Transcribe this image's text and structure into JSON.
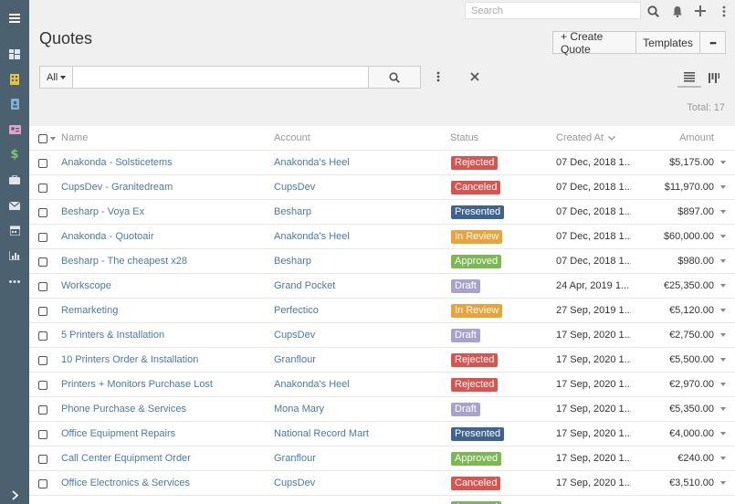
{
  "app": {
    "title": "Quotes"
  },
  "topbar": {
    "search_placeholder": "Search"
  },
  "header": {
    "create_label": "+ Create Quote",
    "templates_label": "Templates",
    "more_label": "•••"
  },
  "filter": {
    "select_value": "All",
    "query": ""
  },
  "total": "Total: 17",
  "table": {
    "columns": {
      "name": "Name",
      "account": "Account",
      "status": "Status",
      "created": "Created At",
      "amount": "Amount"
    },
    "rows": [
      {
        "name": "Anakonda - Solsticetems",
        "account": "Anakonda's Heel",
        "status": "Rejected",
        "created": "07 Dec, 2018 1...",
        "amount": "$5,175.00"
      },
      {
        "name": "CupsDev - Granitedream",
        "account": "CupsDev",
        "status": "Canceled",
        "created": "07 Dec, 2018 1...",
        "amount": "$11,970.00"
      },
      {
        "name": "Besharp - Voya Ex",
        "account": "Besharp",
        "status": "Presented",
        "created": "07 Dec, 2018 1...",
        "amount": "$897.00"
      },
      {
        "name": "Anakonda - Quotoair",
        "account": "Anakonda's Heel",
        "status": "In Review",
        "created": "07 Dec, 2018 1...",
        "amount": "$60,000.00"
      },
      {
        "name": "Besharp - The cheapest x28",
        "account": "Besharp",
        "status": "Approved",
        "created": "07 Dec, 2018 1...",
        "amount": "$980.00"
      },
      {
        "name": "Workscope",
        "account": "Grand Pocket",
        "status": "Draft",
        "created": "24 Apr, 2019 1...",
        "amount": "€25,350.00"
      },
      {
        "name": "Remarketing",
        "account": "Perfectico",
        "status": "In Review",
        "created": "27 Sep, 2019 1...",
        "amount": "€5,120.00"
      },
      {
        "name": "5 Printers & Installation",
        "account": "CupsDev",
        "status": "Draft",
        "created": "17 Sep, 2020 1...",
        "amount": "€2,750.00"
      },
      {
        "name": "10 Printers Order & Installation",
        "account": "Granflour",
        "status": "Rejected",
        "created": "17 Sep, 2020 1...",
        "amount": "€5,500.00"
      },
      {
        "name": "Printers + Monitors Purchase Lost",
        "account": "Anakonda's Heel",
        "status": "Rejected",
        "created": "17 Sep, 2020 1...",
        "amount": "€2,970.00"
      },
      {
        "name": "Phone Purchase & Services",
        "account": "Mona Mary",
        "status": "Draft",
        "created": "17 Sep, 2020 1...",
        "amount": "€5,350.00"
      },
      {
        "name": "Office Equipment Repairs",
        "account": "National Record Mart",
        "status": "Presented",
        "created": "17 Sep, 2020 1...",
        "amount": "€4,000.00"
      },
      {
        "name": "Call Center Equipment Order",
        "account": "Granflour",
        "status": "Approved",
        "created": "17 Sep, 2020 1...",
        "amount": "€240.00"
      },
      {
        "name": "Office Electronics & Services",
        "account": "CupsDev",
        "status": "Canceled",
        "created": "17 Sep, 2020 1...",
        "amount": "€3,510.00"
      },
      {
        "name": "",
        "account": "",
        "status": "Approved",
        "created": "",
        "amount": ""
      }
    ]
  },
  "status_colors": {
    "Rejected": "#d9534f",
    "Canceled": "#d9534f",
    "Presented": "#3e6390",
    "In Review": "#e8a33b",
    "Approved": "#7ab850",
    "Draft": "#a7a3cc"
  },
  "sidebar_icons": [
    "menu-icon",
    "dashboard-icon",
    "building-icon",
    "contact-icon",
    "id-card-icon",
    "dollar-icon",
    "briefcase-icon",
    "envelope-icon",
    "calendar-icon",
    "chart-icon",
    "more-icon",
    "expand-icon"
  ]
}
